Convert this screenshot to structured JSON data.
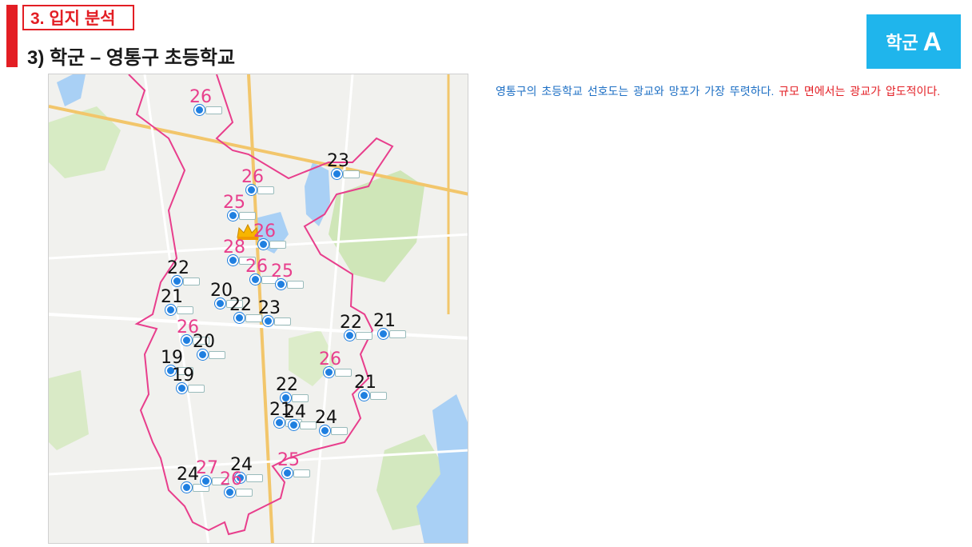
{
  "header": {
    "section_title": "3. 입지 분석",
    "subtitle": "3) 학군 – 영통구 초등학교"
  },
  "badge": {
    "prefix": "학군",
    "letter": "A"
  },
  "description": {
    "blue_text": "영통구의 초등학교 선호도는 광교와 망포가 가장 뚜렷하다. ",
    "red_text": "규모 면에서는 광교가 압도적이다."
  },
  "map": {
    "boundary_color": "#e83e8c",
    "accent_color": "#e31e24",
    "pin_color": "#1f7fe0",
    "top_marker": "crown-icon",
    "scores": [
      {
        "value": "26",
        "color": "pink"
      },
      {
        "value": "23",
        "color": "black"
      },
      {
        "value": "26",
        "color": "pink"
      },
      {
        "value": "25",
        "color": "pink"
      },
      {
        "value": "28",
        "color": "pink"
      },
      {
        "value": "26",
        "color": "pink"
      },
      {
        "value": "26",
        "color": "pink"
      },
      {
        "value": "25",
        "color": "pink"
      },
      {
        "value": "22",
        "color": "black"
      },
      {
        "value": "21",
        "color": "black"
      },
      {
        "value": "20",
        "color": "black"
      },
      {
        "value": "22",
        "color": "black"
      },
      {
        "value": "23",
        "color": "black"
      },
      {
        "value": "26",
        "color": "pink"
      },
      {
        "value": "20",
        "color": "black"
      },
      {
        "value": "19",
        "color": "black"
      },
      {
        "value": "19",
        "color": "black"
      },
      {
        "value": "22",
        "color": "black"
      },
      {
        "value": "21",
        "color": "black"
      },
      {
        "value": "26",
        "color": "pink"
      },
      {
        "value": "22",
        "color": "black"
      },
      {
        "value": "21",
        "color": "black"
      },
      {
        "value": "21",
        "color": "black"
      },
      {
        "value": "24",
        "color": "black"
      },
      {
        "value": "24",
        "color": "black"
      },
      {
        "value": "25",
        "color": "pink"
      },
      {
        "value": "24",
        "color": "black"
      },
      {
        "value": "27",
        "color": "pink"
      },
      {
        "value": "24",
        "color": "black"
      },
      {
        "value": "26",
        "color": "pink"
      }
    ]
  }
}
